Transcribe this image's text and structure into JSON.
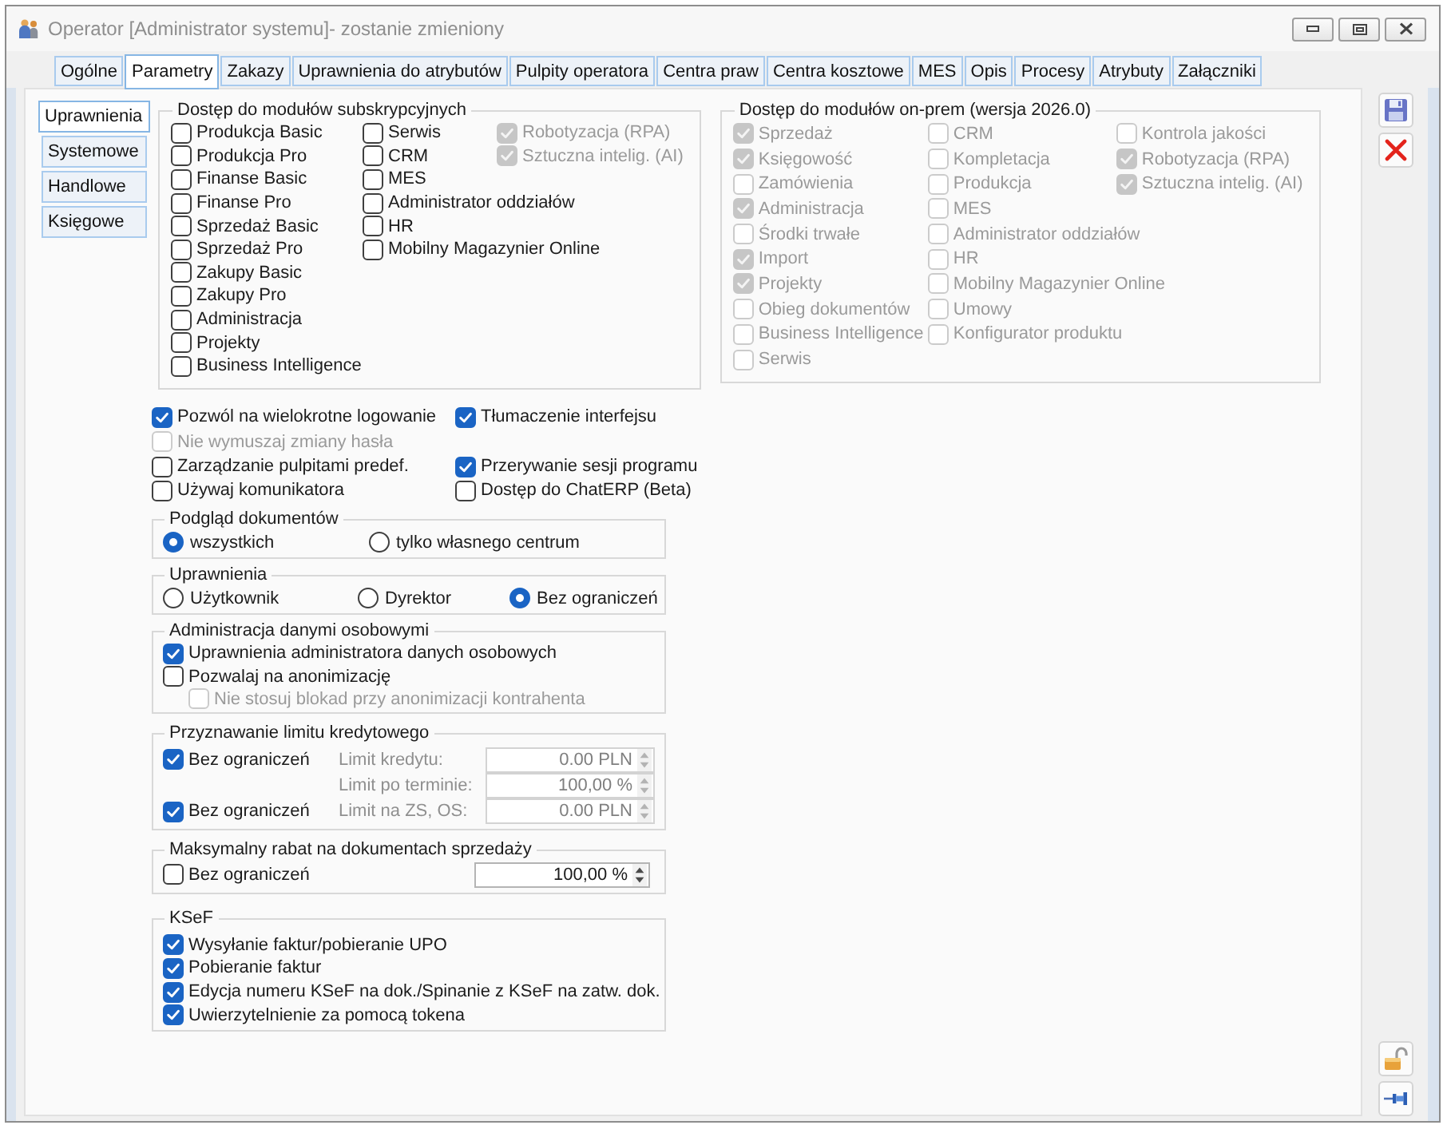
{
  "window": {
    "title": "Operator [Administrator systemu]- zostanie zmieniony"
  },
  "tabs": [
    {
      "label": "Ogólne",
      "selected": false
    },
    {
      "label": "Parametry",
      "selected": true
    },
    {
      "label": "Zakazy",
      "selected": false
    },
    {
      "label": "Uprawnienia do atrybutów",
      "selected": false
    },
    {
      "label": "Pulpity operatora",
      "selected": false
    },
    {
      "label": "Centra praw",
      "selected": false
    },
    {
      "label": "Centra kosztowe",
      "selected": false
    },
    {
      "label": "MES",
      "selected": false
    },
    {
      "label": "Opis",
      "selected": false
    },
    {
      "label": "Procesy",
      "selected": false
    },
    {
      "label": "Atrybuty",
      "selected": false
    },
    {
      "label": "Załączniki",
      "selected": false
    }
  ],
  "side_tabs": [
    {
      "label": "Uprawnienia",
      "selected": true
    },
    {
      "label": "Systemowe",
      "selected": false
    },
    {
      "label": "Handlowe",
      "selected": false
    },
    {
      "label": "Księgowe",
      "selected": false
    }
  ],
  "subscription_modules": {
    "title": "Dostęp do modułów subskrypcyjnych",
    "columns": [
      [
        {
          "label": "Produkcja Basic",
          "checked": false,
          "disabled": false
        },
        {
          "label": "Produkcja Pro",
          "checked": false,
          "disabled": false
        },
        {
          "label": "Finanse Basic",
          "checked": false,
          "disabled": false
        },
        {
          "label": "Finanse Pro",
          "checked": false,
          "disabled": false
        },
        {
          "label": "Sprzedaż Basic",
          "checked": false,
          "disabled": false
        },
        {
          "label": "Sprzedaż Pro",
          "checked": false,
          "disabled": false
        },
        {
          "label": "Zakupy Basic",
          "checked": false,
          "disabled": false
        },
        {
          "label": "Zakupy Pro",
          "checked": false,
          "disabled": false
        },
        {
          "label": "Administracja",
          "checked": false,
          "disabled": false
        },
        {
          "label": "Projekty",
          "checked": false,
          "disabled": false
        },
        {
          "label": "Business Intelligence",
          "checked": false,
          "disabled": false
        }
      ],
      [
        {
          "label": "Serwis",
          "checked": false,
          "disabled": false
        },
        {
          "label": "CRM",
          "checked": false,
          "disabled": false
        },
        {
          "label": "MES",
          "checked": false,
          "disabled": false
        },
        {
          "label": "Administrator oddziałów",
          "checked": false,
          "disabled": false
        },
        {
          "label": "HR",
          "checked": false,
          "disabled": false
        },
        {
          "label": "Mobilny Magazynier Online",
          "checked": false,
          "disabled": false
        }
      ],
      [
        {
          "label": "Robotyzacja (RPA)",
          "checked": true,
          "disabled": true
        },
        {
          "label": "Sztuczna intelig. (AI)",
          "checked": true,
          "disabled": true
        }
      ]
    ]
  },
  "on_prem_modules": {
    "title": "Dostęp do modułów on-prem (wersja 2026.0)",
    "columns": [
      [
        {
          "label": "Sprzedaż",
          "checked": true,
          "disabled": true
        },
        {
          "label": "Księgowość",
          "checked": true,
          "disabled": true
        },
        {
          "label": "Zamówienia",
          "checked": false,
          "disabled": true
        },
        {
          "label": "Administracja",
          "checked": true,
          "disabled": true
        },
        {
          "label": "Środki trwałe",
          "checked": false,
          "disabled": true
        },
        {
          "label": "Import",
          "checked": true,
          "disabled": true
        },
        {
          "label": "Projekty",
          "checked": true,
          "disabled": true
        },
        {
          "label": "Obieg dokumentów",
          "checked": false,
          "disabled": true
        },
        {
          "label": "Business Intelligence",
          "checked": false,
          "disabled": true
        },
        {
          "label": "Serwis",
          "checked": false,
          "disabled": true
        }
      ],
      [
        {
          "label": "CRM",
          "checked": false,
          "disabled": true
        },
        {
          "label": "Kompletacja",
          "checked": false,
          "disabled": true
        },
        {
          "label": "Produkcja",
          "checked": false,
          "disabled": true
        },
        {
          "label": "MES",
          "checked": false,
          "disabled": true
        },
        {
          "label": "Administrator oddziałów",
          "checked": false,
          "disabled": true
        },
        {
          "label": "HR",
          "checked": false,
          "disabled": true
        },
        {
          "label": "Mobilny Magazynier Online",
          "checked": false,
          "disabled": true
        },
        {
          "label": "Umowy",
          "checked": false,
          "disabled": true
        },
        {
          "label": "Konfigurator produktu",
          "checked": false,
          "disabled": true
        }
      ],
      [
        {
          "label": "Kontrola jakości",
          "checked": false,
          "disabled": true
        },
        {
          "label": "Robotyzacja (RPA)",
          "checked": true,
          "disabled": true
        },
        {
          "label": "Sztuczna intelig. (AI)",
          "checked": true,
          "disabled": true
        }
      ]
    ]
  },
  "options": [
    {
      "items": [
        {
          "label": "Pozwól na wielokrotne logowanie",
          "checked": true,
          "disabled": false
        },
        {
          "label": "Tłumaczenie interfejsu",
          "checked": true,
          "disabled": false
        }
      ]
    },
    {
      "items": [
        {
          "label": "Nie wymuszaj zmiany hasła",
          "checked": false,
          "disabled": true
        }
      ]
    },
    {
      "items": [
        {
          "label": "Zarządzanie pulpitami predef.",
          "checked": false,
          "disabled": false
        },
        {
          "label": "Przerywanie sesji programu",
          "checked": true,
          "disabled": false
        }
      ]
    },
    {
      "items": [
        {
          "label": "Używaj komunikatora",
          "checked": false,
          "disabled": false
        },
        {
          "label": "Dostęp do ChatERP (Beta)",
          "checked": false,
          "disabled": false
        }
      ]
    }
  ],
  "document_preview": {
    "title": "Podgląd dokumentów",
    "options": [
      {
        "label": "wszystkich",
        "selected": true
      },
      {
        "label": "tylko własnego centrum",
        "selected": false
      }
    ]
  },
  "permissions": {
    "title": "Uprawnienia",
    "options": [
      {
        "label": "Użytkownik",
        "selected": false
      },
      {
        "label": "Dyrektor",
        "selected": false
      },
      {
        "label": "Bez ograniczeń",
        "selected": true
      }
    ]
  },
  "personal_data": {
    "title": "Administracja danymi osobowymi",
    "items": [
      {
        "label": "Uprawnienia administratora danych osobowych",
        "checked": true,
        "disabled": false
      },
      {
        "label": "Pozwalaj na anonimizację",
        "checked": false,
        "disabled": false,
        "children": [
          {
            "label": "Nie stosuj blokad przy anonimizacji kontrahenta",
            "checked": false,
            "disabled": true
          }
        ]
      }
    ]
  },
  "credit_limit": {
    "title": "Przyznawanie limitu kredytowego",
    "rows": [
      {
        "checkbox": {
          "label": "Bez ograniczeń",
          "checked": true
        },
        "field": {
          "label": "Limit kredytu:",
          "value": "0.00 PLN",
          "disabled": true
        }
      },
      {
        "field": {
          "label": "Limit po terminie:",
          "value": "100,00 %",
          "disabled": true
        }
      },
      {
        "checkbox": {
          "label": "Bez ograniczeń",
          "checked": true
        },
        "field": {
          "label": "Limit na ZS, OS:",
          "value": "0.00 PLN",
          "disabled": true
        }
      }
    ]
  },
  "max_discount": {
    "title": "Maksymalny rabat na dokumentach sprzedaży",
    "checkbox": {
      "label": "Bez ograniczeń",
      "checked": false
    },
    "field": {
      "value": "100,00 %",
      "disabled": false
    }
  },
  "ksef": {
    "title": "KSeF",
    "items": [
      {
        "label": "Wysyłanie faktur/pobieranie UPO",
        "checked": true
      },
      {
        "label": "Pobieranie faktur",
        "checked": true
      },
      {
        "label": "Edycja numeru KSeF na dok./Spinanie z KSeF na zatw. dok.",
        "checked": true
      },
      {
        "label": "Uwierzytelnienie za pomocą tokena",
        "checked": true
      }
    ]
  }
}
